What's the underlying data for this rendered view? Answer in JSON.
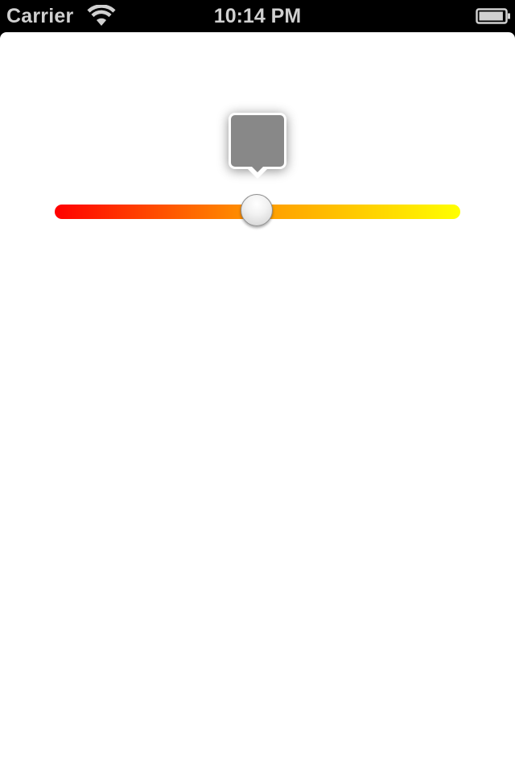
{
  "status_bar": {
    "carrier": "Carrier",
    "time": "10:14 PM",
    "wifi_icon": "wifi-icon",
    "battery_icon": "battery-icon",
    "battery_level": 0.95
  },
  "color_slider": {
    "value": 0.5,
    "gradient_colors": [
      "#ff0000",
      "#ff9900",
      "#ffff00"
    ],
    "popover_color": "#888888"
  }
}
